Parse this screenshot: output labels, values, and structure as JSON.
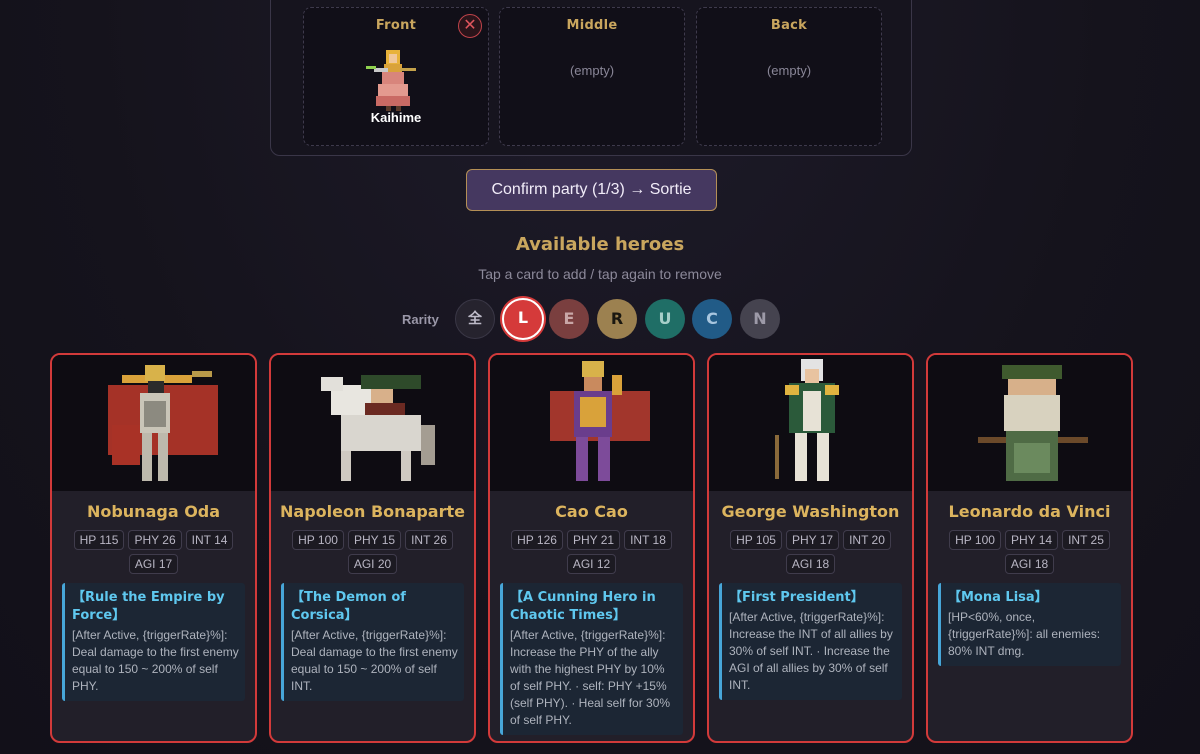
{
  "party": {
    "slots": [
      {
        "title": "Front",
        "hero": "Kaihime",
        "empty_text": ""
      },
      {
        "title": "Middle",
        "hero": "",
        "empty_text": "(empty)"
      },
      {
        "title": "Back",
        "hero": "",
        "empty_text": "(empty)"
      }
    ],
    "remove_icon": "close-icon"
  },
  "confirm_label": "Confirm party (1/3) → Sortie",
  "heroes_section": {
    "title": "Available heroes",
    "hint": "Tap a card to add / tap again to remove"
  },
  "rarity_filter": {
    "label": "Rarity",
    "options": [
      {
        "label": "全",
        "color": "#26232e",
        "text_color": "#bdbac8",
        "selected": false
      },
      {
        "label": "L",
        "color": "#d53a3a",
        "text_color": "#ffffff",
        "selected": true
      },
      {
        "label": "E",
        "color": "#7a3f3f",
        "text_color": "#c9a7a7",
        "selected": false
      },
      {
        "label": "R",
        "color": "#9c8150",
        "text_color": "#1a1710",
        "selected": false
      },
      {
        "label": "U",
        "color": "#1f6e66",
        "text_color": "#a7cfc9",
        "selected": false
      },
      {
        "label": "C",
        "color": "#215b87",
        "text_color": "#a8c6df",
        "selected": false
      },
      {
        "label": "N",
        "color": "#45434f",
        "text_color": "#9d9aa8",
        "selected": false
      }
    ]
  },
  "heroes": [
    {
      "name": "Nobunaga Oda",
      "stats": [
        "HP 115",
        "PHY 26",
        "INT 14",
        "AGI 17"
      ],
      "skill_name": "【Rule the Empire by Force】",
      "skill_desc": "[After Active, {triggerRate}%]: Deal damage to the first enemy equal to 150 ~ 200% of self PHY."
    },
    {
      "name": "Napoleon Bonaparte",
      "stats": [
        "HP 100",
        "PHY 15",
        "INT 26",
        "AGI 20"
      ],
      "skill_name": "【The Demon of Corsica】",
      "skill_desc": "[After Active, {triggerRate}%]: Deal damage to the first enemy equal to 150 ~ 200% of self INT."
    },
    {
      "name": "Cao Cao",
      "stats": [
        "HP 126",
        "PHY 21",
        "INT 18",
        "AGI 12"
      ],
      "skill_name": "【A Cunning Hero in Chaotic Times】",
      "skill_desc": "[After Active, {triggerRate}%]: Increase the PHY of the ally with the highest PHY by 10% of self PHY. · self: PHY +15% (self PHY). · Heal self for 30% of self PHY."
    },
    {
      "name": "George Washington",
      "stats": [
        "HP 105",
        "PHY 17",
        "INT 20",
        "AGI 18"
      ],
      "skill_name": "【First President】",
      "skill_desc": "[After Active, {triggerRate}%]: Increase the INT of all allies by 30% of self INT. · Increase the AGI of all allies by 30% of self INT."
    },
    {
      "name": "Leonardo da Vinci",
      "stats": [
        "HP 100",
        "PHY 14",
        "INT 25",
        "AGI 18"
      ],
      "skill_name": "【Mona Lisa】",
      "skill_desc": "[HP<60%, once, {triggerRate}%]: all enemies: 80% INT dmg."
    }
  ]
}
